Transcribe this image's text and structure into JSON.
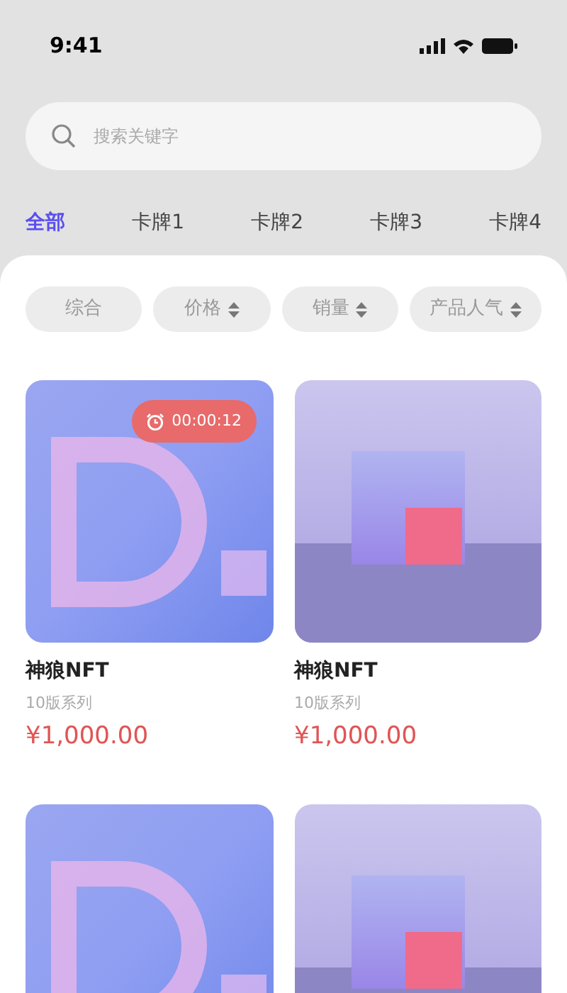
{
  "status_bar": {
    "time": "9:41"
  },
  "search": {
    "placeholder": "搜索关键字"
  },
  "tabs": [
    {
      "label": "全部",
      "selected": true
    },
    {
      "label": "卡牌1",
      "selected": false
    },
    {
      "label": "卡牌2",
      "selected": false
    },
    {
      "label": "卡牌3",
      "selected": false
    },
    {
      "label": "卡牌4",
      "selected": false
    }
  ],
  "filters": [
    {
      "label": "综合",
      "kind": "plain"
    },
    {
      "label": "价格",
      "kind": "sort"
    },
    {
      "label": "销量",
      "kind": "sort"
    },
    {
      "label": "产品人气",
      "kind": "sort"
    }
  ],
  "products": [
    {
      "kind": "letter",
      "timer": "00:00:12",
      "title": "神狼NFT",
      "series": "10版系列",
      "price": "¥1,000.00"
    },
    {
      "kind": "cube",
      "title": "神狼NFT",
      "series": "10版系列",
      "price": "¥1,000.00"
    },
    {
      "kind": "letter"
    },
    {
      "kind": "cube"
    }
  ]
}
